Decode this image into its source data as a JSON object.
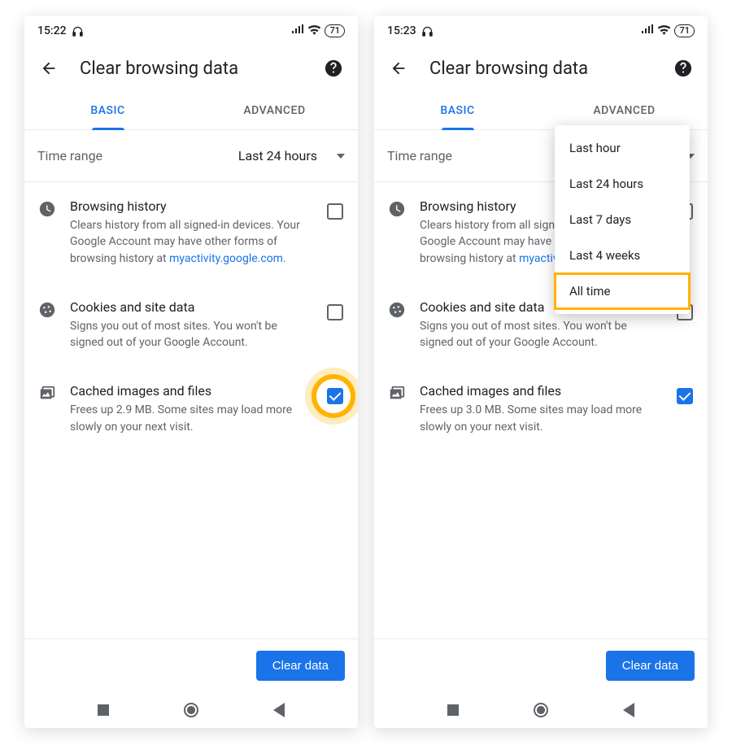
{
  "screens": [
    {
      "statusbar": {
        "time": "15:22",
        "battery": "71"
      },
      "header": {
        "title": "Clear browsing data"
      },
      "tabs": {
        "basic": "BASIC",
        "advanced": "ADVANCED"
      },
      "timerange": {
        "label": "Time range",
        "value": "Last 24 hours"
      },
      "items": {
        "history": {
          "title": "Browsing history",
          "desc_pre": "Clears history from all signed-in devices. Your Google Account may have other forms of browsing history at ",
          "link": "myactivity.google.com",
          "desc_post": "."
        },
        "cookies": {
          "title": "Cookies and site data",
          "desc": "Signs you out of most sites. You won't be signed out of your Google Account."
        },
        "cache": {
          "title": "Cached images and files",
          "desc": "Frees up 2.9 MB. Some sites may load more slowly on your next visit."
        }
      },
      "button": "Clear data"
    },
    {
      "statusbar": {
        "time": "15:23",
        "battery": "71"
      },
      "header": {
        "title": "Clear browsing data"
      },
      "tabs": {
        "basic": "BASIC",
        "advanced": "ADVANCED"
      },
      "timerange": {
        "label": "Time range",
        "value": ""
      },
      "dropdown": {
        "options": [
          "Last hour",
          "Last 24 hours",
          "Last 7 days",
          "Last 4 weeks",
          "All time"
        ]
      },
      "items": {
        "history": {
          "title": "Browsing history",
          "desc_pre": "Clears history from all signed-in devices. Your Google Account may have other forms of browsing history at ",
          "link": "myactivity.google.com",
          "desc_post": "."
        },
        "cookies": {
          "title": "Cookies and site data",
          "desc": "Signs you out of most sites. You won't be signed out of your Google Account."
        },
        "cache": {
          "title": "Cached images and files",
          "desc": "Frees up 3.0 MB. Some sites may load more slowly on your next visit."
        }
      },
      "button": "Clear data"
    }
  ]
}
